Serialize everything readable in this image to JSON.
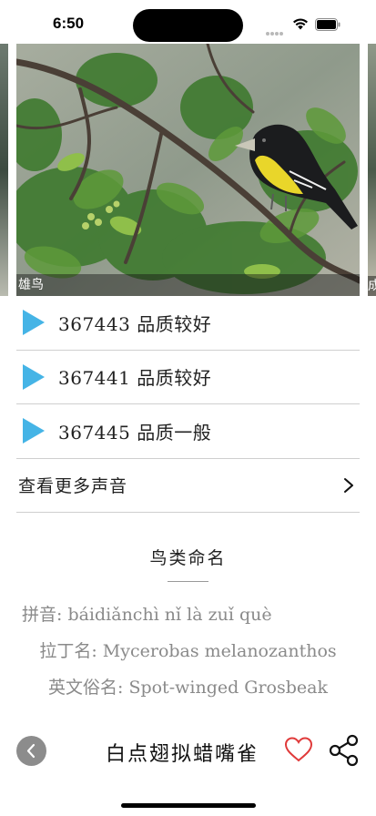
{
  "status_bar": {
    "time": "6:50"
  },
  "carousel": {
    "caption": "雄鸟",
    "next_caption": "成"
  },
  "sounds": [
    {
      "label": "367443 品质较好"
    },
    {
      "label": "367441 品质较好"
    },
    {
      "label": "367445 品质一般"
    }
  ],
  "more_sounds_label": "查看更多声音",
  "naming": {
    "title": "鸟类命名",
    "pinyin": "拼音: báidiǎnchì nǐ là zuǐ què",
    "latin": "拉丁名: Mycerobas melanozanthos",
    "english": "英文俗名: Spot-winged Grosbeak"
  },
  "bottom_bar": {
    "bird_name": "白点翅拟蜡嘴雀"
  },
  "colors": {
    "accent": "#45b4e6",
    "heart": "#e03a3a",
    "back_button": "#8c8c8c"
  }
}
